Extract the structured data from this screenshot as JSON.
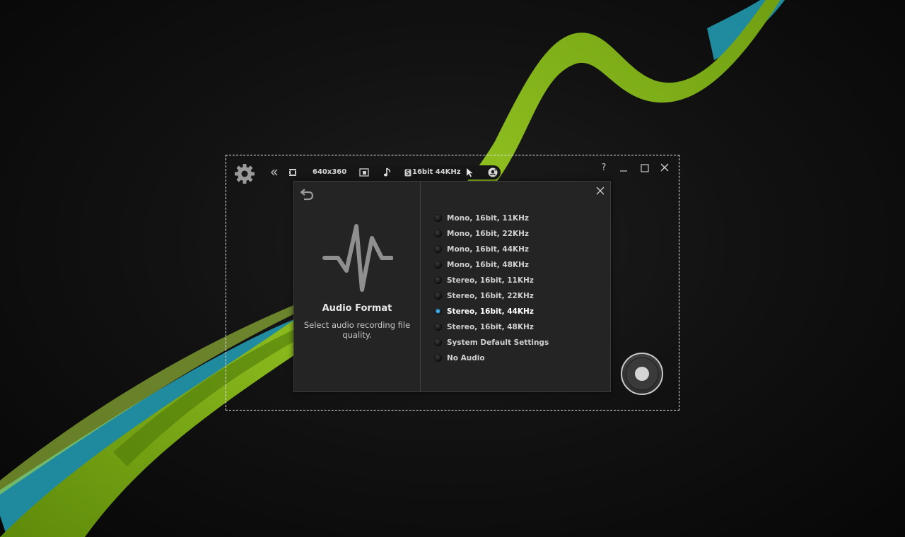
{
  "toolbar": {
    "resolution": "640x360",
    "audio_format": "16bit 44KHz"
  },
  "window_controls": {
    "help": "?"
  },
  "audio_panel": {
    "title": "Audio Format",
    "description": "Select audio recording file quality.",
    "options": [
      {
        "label": "Mono, 16bit, 11KHz",
        "selected": false
      },
      {
        "label": "Mono, 16bit, 22KHz",
        "selected": false
      },
      {
        "label": "Mono, 16bit, 44KHz",
        "selected": false
      },
      {
        "label": "Mono, 16bit, 48KHz",
        "selected": false
      },
      {
        "label": "Stereo, 16bit, 11KHz",
        "selected": false
      },
      {
        "label": "Stereo, 16bit, 22KHz",
        "selected": false
      },
      {
        "label": "Stereo, 16bit, 44KHz",
        "selected": true
      },
      {
        "label": "Stereo, 16bit, 48KHz",
        "selected": false
      },
      {
        "label": "System Default Settings",
        "selected": false
      },
      {
        "label": "No Audio",
        "selected": false
      }
    ]
  },
  "icons": [
    "settings-gear-icon",
    "collapse-toolbar-icon",
    "video-frame-icon",
    "fullscreen-icon",
    "music-note-icon",
    "audio-format-icon",
    "cursor-icon",
    "webcam-icon",
    "back-arrow-icon",
    "waveform-icon",
    "close-icon",
    "record-icon"
  ],
  "colors": {
    "accent": "#39aef0",
    "ribbon_green": "#8ec21a",
    "ribbon_teal": "#22a5c0",
    "panel_bg": "#242424"
  }
}
